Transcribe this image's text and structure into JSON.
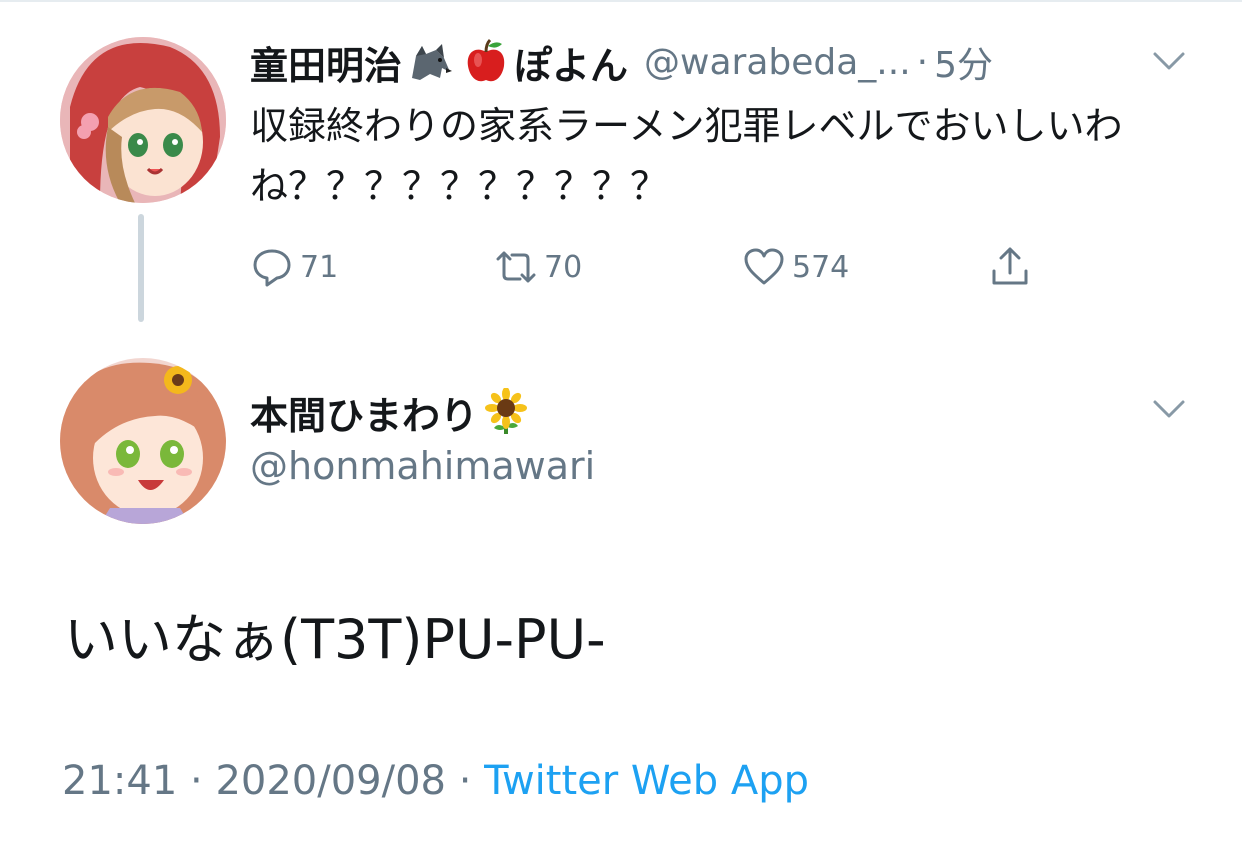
{
  "tweet1": {
    "display_name": "童田明治",
    "display_name_suffix": "ぽよん",
    "handle": "@warabeda_...",
    "separator": "·",
    "time": "5分",
    "text": "収録終わりの家系ラーメン犯罪レベルでおいしいわね？？？？？？？？？？",
    "emoji": [
      "wolf-emoji",
      "apple-emoji"
    ],
    "reply_count": "71",
    "retweet_count": "70",
    "like_count": "574"
  },
  "tweet2": {
    "display_name": "本間ひまわり",
    "emoji": [
      "sunflower-emoji"
    ],
    "handle": "@honmahimawari",
    "text": "いいなぁ(T3T)PU-PU-",
    "time": "21:41",
    "date": "2020/09/08",
    "separator": "·",
    "source": "Twitter Web App"
  },
  "colors": {
    "text_primary": "#14171a",
    "text_secondary": "#657786",
    "link": "#1da1f2",
    "thread_line": "#ccd6dd"
  }
}
